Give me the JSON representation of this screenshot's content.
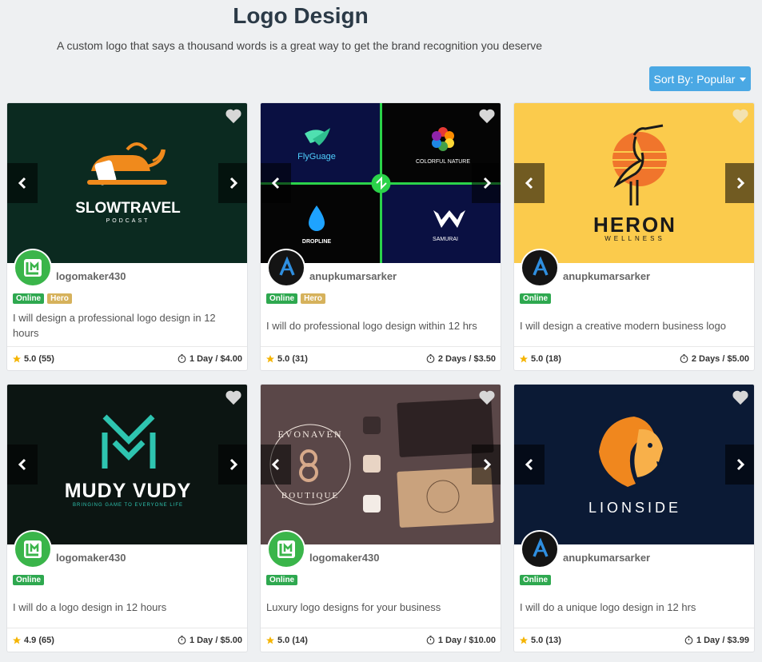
{
  "header": {
    "title": "Logo Design",
    "subtitle": "A custom logo that says a thousand words is a great way to get the brand recognition you deserve",
    "sort_label": "Sort By: Popular"
  },
  "cards": [
    {
      "image_text": "SLOWTRAVEL",
      "image_subtext": "PODCAST",
      "seller": "logomaker430",
      "badges": [
        "Online",
        "Hero"
      ],
      "description": "I will design a professional logo design in 12 hours",
      "rating": "5.0 (55)",
      "delivery": "1 Day / $4.00"
    },
    {
      "image_labels": [
        "FlyGuage",
        "COLORFUL NATURE",
        "DROPLINE",
        "SAMURAI"
      ],
      "seller": "anupkumarsarker",
      "badges": [
        "Online",
        "Hero"
      ],
      "description": "I will do professional logo design within 12 hrs",
      "rating": "5.0 (31)",
      "delivery": "2 Days / $3.50"
    },
    {
      "image_text": "HERON",
      "image_subtext": "WELLNESS",
      "seller": "anupkumarsarker",
      "badges": [
        "Online"
      ],
      "description": "I will design a creative modern business logo",
      "rating": "5.0 (18)",
      "delivery": "2 Days / $5.00"
    },
    {
      "image_text": "MUDY VUDY",
      "image_subtext": "BRINGING GAME TO EVERYONE LIFE",
      "seller": "logomaker430",
      "badges": [
        "Online"
      ],
      "description": "I will do a logo design in 12 hours",
      "rating": "4.9 (65)",
      "delivery": "1 Day / $5.00"
    },
    {
      "image_text": "EVONAVEN",
      "image_subtext": "BOUTIQUE",
      "seller": "logomaker430",
      "badges": [
        "Online"
      ],
      "description": "Luxury logo designs for your business",
      "rating": "5.0 (14)",
      "delivery": "1 Day / $10.00"
    },
    {
      "image_text": "LIONSIDE",
      "seller": "anupkumarsarker",
      "badges": [
        "Online"
      ],
      "description": "I will do a unique logo design in 12 hrs",
      "rating": "5.0 (13)",
      "delivery": "1 Day / $3.99"
    }
  ],
  "colors": {
    "accent": "#4aa8e4",
    "online": "#2ea84f",
    "hero": "#d6b25c",
    "star": "#f5b400"
  }
}
